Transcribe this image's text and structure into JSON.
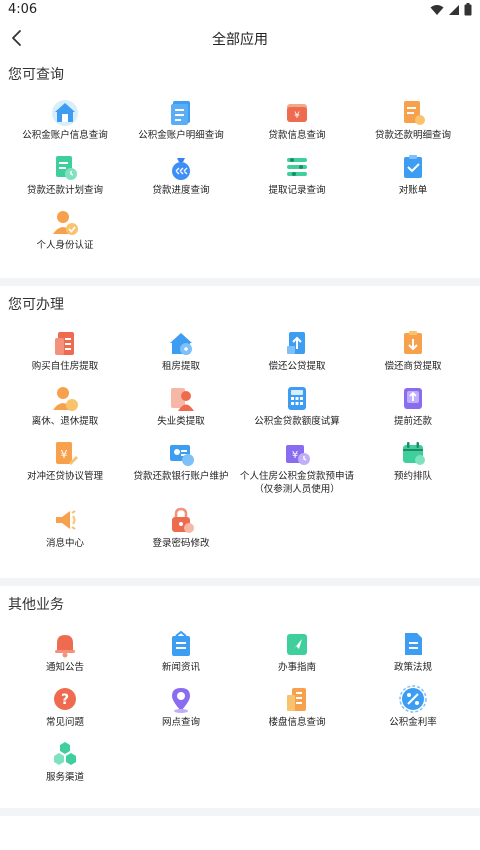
{
  "status": {
    "time": "4:06"
  },
  "header": {
    "title": "全部应用",
    "back_icon": "back-arrow-icon"
  },
  "sections": [
    {
      "title": "您可查询",
      "items": [
        {
          "label": "公积金账户信息查询",
          "icon": "house-account-icon"
        },
        {
          "label": "公积金账户明细查询",
          "icon": "document-detail-icon"
        },
        {
          "label": "贷款信息查询",
          "icon": "wallet-icon"
        },
        {
          "label": "贷款还款明细查询",
          "icon": "repay-detail-icon"
        },
        {
          "label": "贷款还款计划查询",
          "icon": "repay-plan-icon"
        },
        {
          "label": "贷款进度查询",
          "icon": "money-bag-progress-icon"
        },
        {
          "label": "提取记录查询",
          "icon": "record-list-icon"
        },
        {
          "label": "对账单",
          "icon": "statement-check-icon"
        },
        {
          "label": "个人身份认证",
          "icon": "identity-verify-icon"
        }
      ]
    },
    {
      "title": "您可办理",
      "items": [
        {
          "label": "购买自住房提取",
          "icon": "buy-house-icon"
        },
        {
          "label": "租房提取",
          "icon": "rent-house-icon"
        },
        {
          "label": "偿还公贷提取",
          "icon": "repay-public-loan-icon"
        },
        {
          "label": "偿还商贷提取",
          "icon": "repay-commercial-loan-icon"
        },
        {
          "label": "离休、退休提取",
          "icon": "retire-icon"
        },
        {
          "label": "失业类提取",
          "icon": "unemployment-icon"
        },
        {
          "label": "公积金贷款额度试算",
          "icon": "calculator-icon"
        },
        {
          "label": "提前还款",
          "icon": "early-repay-icon"
        },
        {
          "label": "对冲还贷协议管理",
          "icon": "offset-agreement-icon"
        },
        {
          "label": "贷款还款银行账户维护",
          "icon": "bank-account-icon"
        },
        {
          "label": "个人住房公积金贷款预申请",
          "label2": "（仅参测人员使用）",
          "icon": "pre-apply-icon"
        },
        {
          "label": "预约排队",
          "icon": "calendar-icon"
        },
        {
          "label": "消息中心",
          "icon": "megaphone-icon"
        },
        {
          "label": "登录密码修改",
          "icon": "lock-icon"
        }
      ]
    },
    {
      "title": "其他业务",
      "items": [
        {
          "label": "通知公告",
          "icon": "bell-icon"
        },
        {
          "label": "新闻资讯",
          "icon": "news-icon"
        },
        {
          "label": "办事指南",
          "icon": "guide-icon"
        },
        {
          "label": "政策法规",
          "icon": "policy-doc-icon"
        },
        {
          "label": "常见问题",
          "icon": "question-icon"
        },
        {
          "label": "网点查询",
          "icon": "location-pin-icon"
        },
        {
          "label": "楼盘信息查询",
          "icon": "building-icon"
        },
        {
          "label": "公积金利率",
          "icon": "percent-icon"
        },
        {
          "label": "服务渠道",
          "icon": "hexagon-cluster-icon"
        }
      ]
    }
  ]
}
